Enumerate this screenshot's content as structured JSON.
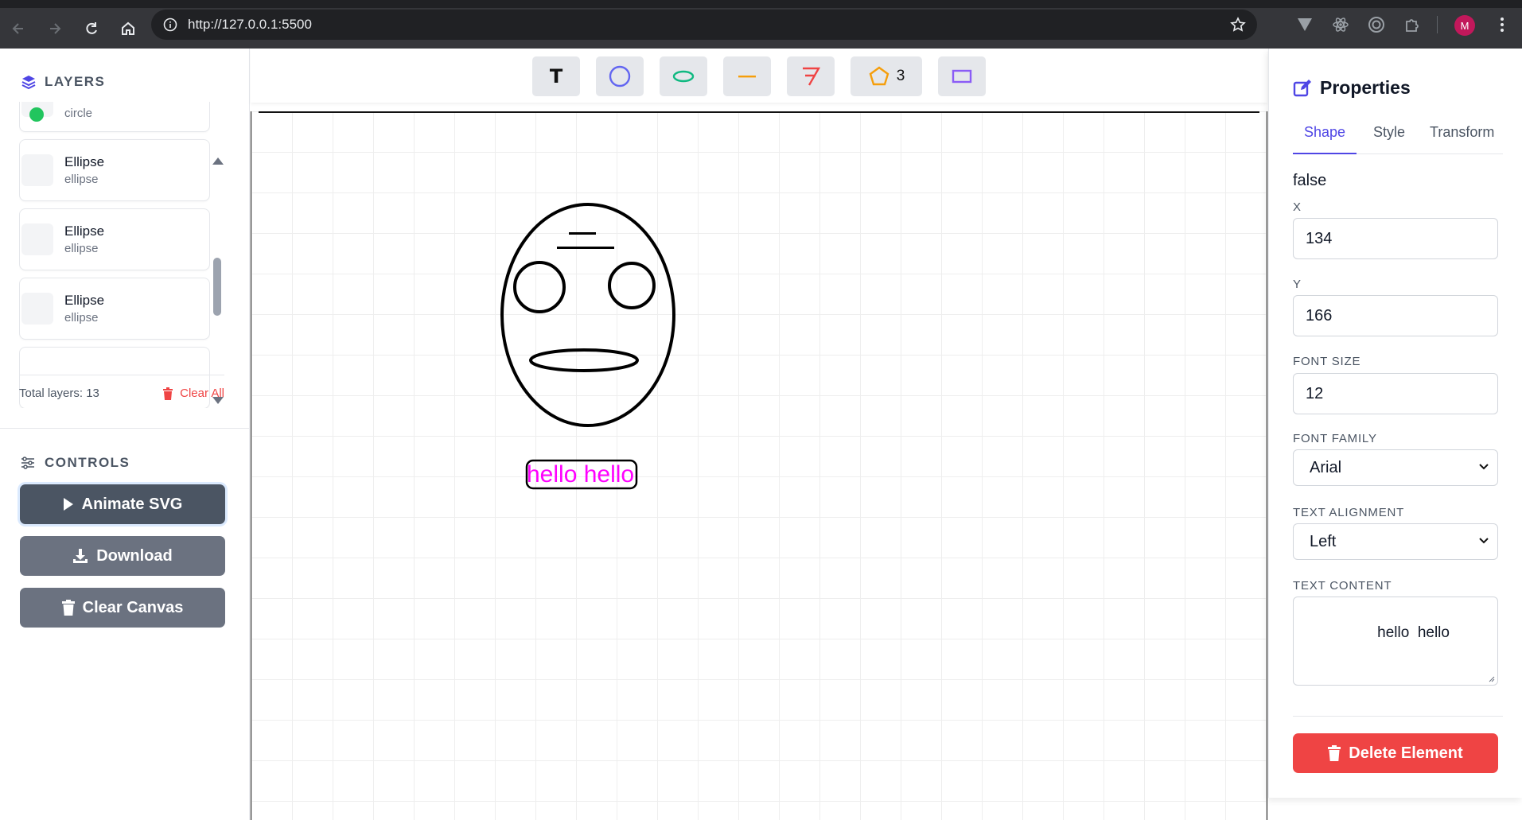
{
  "browser": {
    "url": "http://127.0.0.1:5500",
    "avatar_initial": "M"
  },
  "layers": {
    "title": "LAYERS",
    "items": [
      {
        "name": "",
        "type": "circle"
      },
      {
        "name": "Ellipse",
        "type": "ellipse"
      },
      {
        "name": "Ellipse",
        "type": "ellipse"
      },
      {
        "name": "Ellipse",
        "type": "ellipse"
      }
    ],
    "total_label": "Total layers: 13",
    "clear_all_label": "Clear All"
  },
  "controls": {
    "title": "CONTROLS",
    "animate_label": "Animate SVG",
    "download_label": "Download",
    "clear_canvas_label": "Clear Canvas"
  },
  "toolbar": {
    "text_tool_label": "T",
    "polygon_sides": "3",
    "tools": [
      "text-tool",
      "circle-tool",
      "ellipse-tool",
      "line-tool",
      "path-tool",
      "polygon-tool",
      "rectangle-tool"
    ]
  },
  "canvas": {
    "text_element": "hello hello",
    "text_color": "#ff00ff"
  },
  "properties": {
    "title": "Properties",
    "tabs": [
      "Shape",
      "Style",
      "Transform"
    ],
    "active_tab": "Shape",
    "status_value": "false",
    "x_label": "X",
    "x_value": "134",
    "y_label": "Y",
    "y_value": "166",
    "font_size_label": "FONT SIZE",
    "font_size_value": "12",
    "font_family_label": "FONT FAMILY",
    "font_family_value": "Arial",
    "text_alignment_label": "TEXT ALIGNMENT",
    "text_alignment_value": "Left",
    "text_content_label": "TEXT CONTENT",
    "text_content_value": "hello  hello",
    "delete_label": "Delete Element"
  },
  "colors": {
    "accent": "#4f46e5",
    "danger": "#ef4444",
    "button_dark": "#4b5563",
    "button_gray": "#6b7280"
  }
}
